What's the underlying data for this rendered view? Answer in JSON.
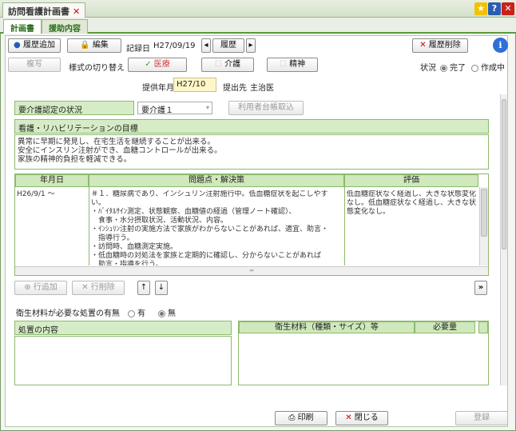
{
  "window": {
    "tab_title": "訪問看護計画書",
    "close_x": "✕"
  },
  "subtabs": [
    "計画書",
    "援助内容"
  ],
  "toolbar": {
    "add_history": "履歴追加",
    "edit": "編集",
    "record_date_label": "記録日",
    "record_date": "H27/09/19",
    "history": "履歴",
    "delete_history": "履歴削除",
    "copy": "複写",
    "style_switch_label": "様式の切り替え",
    "medical": "医療",
    "care": "介護",
    "mental": "精神",
    "status_label": "状況",
    "status_done": "完了",
    "status_creating": "作成中"
  },
  "provision": {
    "year_month_label": "提供年月",
    "year_month": "H27/10",
    "submit_to_label": "提出先",
    "submit_to": "主治医"
  },
  "care_level": {
    "label": "要介護認定の状況",
    "value": "要介護１",
    "import_button": "利用者台帳取込"
  },
  "goal": {
    "label": "看護・リハビリテーションの目標",
    "text": "異常に早期に発見し、在宅生活を継続することが出来る。\n安全にインスリン注射ができ、血糖コントロールが出来る。\n家族の精神的負担を軽減できる。"
  },
  "plan_table": {
    "headers": [
      "年月日",
      "問題点・解決策",
      "評価"
    ],
    "rows": [
      {
        "date": "H26/9/1 ～",
        "problem": "＃１．糖尿病であり、インシュリン注射施行中。低血糖症状を起こしやすい。\n・ﾊﾞｲﾀﾙｻｲﾝ測定、状態観察、血糖値の経過（管理ノート確認）、\n　食事・水分摂取状況、活動状況、内容。\n・ｲﾝｼｭﾘﾝ注射の実施方法で家族がわからないことがあれば、適宜、助言・\n　指導行う。\n・訪問時、血糖測定実施。\n・低血糖時の対処法を家族と定期的に確認し、分からないことがあれば\n　助言・指導を行う。\n・異常が見られた時には、家族へ報告行い、必要に応じて、医師へ報告行",
        "evaluation": "低血糖症状なく経過し、大きな状態変化なし。低血糖症状なく経過し、大きな状態変化なし。"
      }
    ]
  },
  "row_controls": {
    "add_row": "行追加",
    "delete_row": "行削除",
    "up": "↑",
    "down": "↓"
  },
  "hygiene": {
    "question": "衛生材料が必要な処置の有無",
    "yes": "有",
    "no": "無",
    "selected": "無"
  },
  "treatment": {
    "label": "処置の内容",
    "materials_header": "衛生材料（種類・サイズ）等",
    "quantity_header": "必要量"
  },
  "footer": {
    "print": "印刷",
    "close": "閉じる",
    "register": "登録"
  },
  "colors": {
    "accent_green": "#5a9a3a",
    "header_green": "#d6ecc6",
    "delete_red": "#d00000",
    "info_blue": "#2f6fd6",
    "date_highlight": "#fff6c8"
  }
}
